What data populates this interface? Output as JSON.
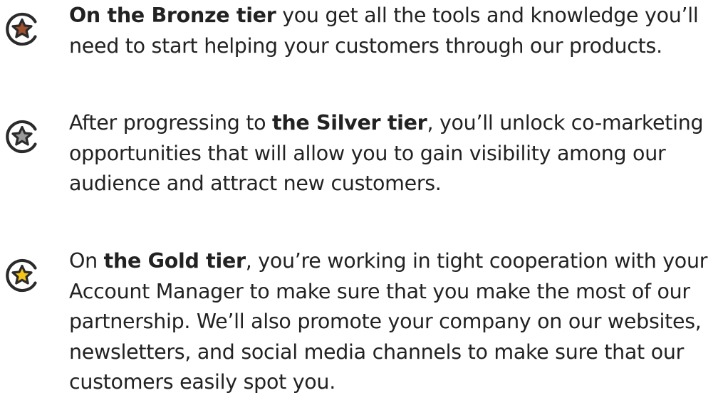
{
  "colors": {
    "text": "#222222",
    "icon_outline": "#2b2b2b",
    "bronze_star": "#a0522d",
    "silver_star": "#9a9a9a",
    "gold_star": "#f5c518"
  },
  "tiers": [
    {
      "id": "bronze",
      "icon": "bronze-star-badge-icon",
      "lines": [
        {
          "before": "",
          "bold": "On the Bronze tier",
          "after": " you get all the tools and knowledge you’ll"
        },
        {
          "before": "need to start helping your customers through our products.",
          "bold": "",
          "after": ""
        }
      ]
    },
    {
      "id": "silver",
      "icon": "silver-star-badge-icon",
      "lines": [
        {
          "before": "After progressing to ",
          "bold": "the Silver tier",
          "after": ", you’ll unlock co-marketing"
        },
        {
          "before": "opportunities that will allow you to gain visibility among our",
          "bold": "",
          "after": ""
        },
        {
          "before": "audience and attract new customers.",
          "bold": "",
          "after": ""
        }
      ]
    },
    {
      "id": "gold",
      "icon": "gold-star-badge-icon",
      "lines": [
        {
          "before": "On ",
          "bold": "the Gold tier",
          "after": ", you’re working in tight cooperation with your"
        },
        {
          "before": "Account Manager to make sure that you make the most of our",
          "bold": "",
          "after": ""
        },
        {
          "before": "partnership. We’ll also promote your company on our websites,",
          "bold": "",
          "after": ""
        },
        {
          "before": "newsletters, and social media channels to make sure that our",
          "bold": "",
          "after": ""
        },
        {
          "before": "customers easily spot you.",
          "bold": "",
          "after": ""
        }
      ]
    }
  ]
}
